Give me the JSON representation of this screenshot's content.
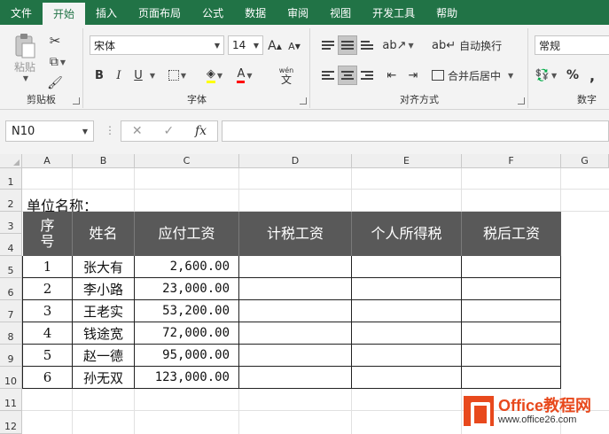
{
  "ribbon_tabs": [
    "文件",
    "开始",
    "插入",
    "页面布局",
    "公式",
    "数据",
    "审阅",
    "视图",
    "开发工具",
    "帮助"
  ],
  "active_tab": "开始",
  "groups": {
    "clipboard": {
      "label": "剪贴板",
      "paste": "粘贴"
    },
    "font": {
      "label": "字体",
      "font_name": "宋体",
      "font_size": "14",
      "bold": "B",
      "italic": "I",
      "underline": "U",
      "grow": "A",
      "shrink": "A",
      "phonetic": "wén"
    },
    "alignment": {
      "label": "对齐方式",
      "wrap": "自动换行",
      "merge": "合并后居中"
    },
    "number": {
      "label": "数字",
      "format": "常规",
      "percent": "%",
      "comma": ","
    }
  },
  "formula_bar": {
    "name_box": "N10",
    "fx": "fx",
    "formula": ""
  },
  "columns": [
    "A",
    "B",
    "C",
    "D",
    "E",
    "F",
    "G"
  ],
  "rows": [
    "1",
    "2",
    "3",
    "4",
    "5",
    "6",
    "7",
    "8",
    "9",
    "10",
    "11",
    "12"
  ],
  "sheet": {
    "unit_label": "单位名称：",
    "headers": {
      "seq_line1": "序",
      "seq_line2": "号",
      "name": "姓名",
      "pay": "应付工资",
      "taxable": "计税工资",
      "tax": "个人所得税",
      "net": "税后工资"
    },
    "records": [
      {
        "seq": "1",
        "name": "张大有",
        "pay": "2,600.00"
      },
      {
        "seq": "2",
        "name": "李小路",
        "pay": "23,000.00"
      },
      {
        "seq": "3",
        "name": "王老实",
        "pay": "53,200.00"
      },
      {
        "seq": "4",
        "name": "钱途宽",
        "pay": "72,000.00"
      },
      {
        "seq": "5",
        "name": "赵一德",
        "pay": "95,000.00"
      },
      {
        "seq": "6",
        "name": "孙无双",
        "pay": "123,000.00"
      }
    ]
  },
  "watermark": {
    "brand": "Office教程网",
    "url": "www.office26.com"
  },
  "colors": {
    "brand": "#217346",
    "header_fill": "#595959",
    "watermark": "#e8491d"
  }
}
